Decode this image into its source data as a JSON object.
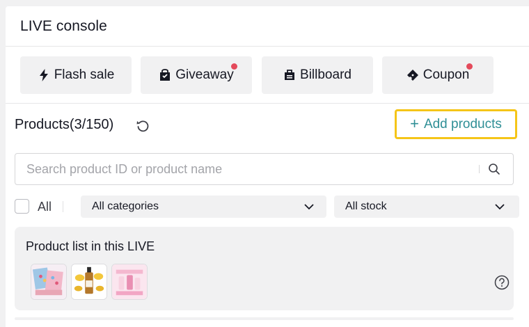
{
  "header": {
    "title": "LIVE console"
  },
  "tools": [
    {
      "label": "Flash sale",
      "icon": "lightning-icon",
      "notification": false
    },
    {
      "label": "Giveaway",
      "icon": "gift-bag-icon",
      "notification": true
    },
    {
      "label": "Billboard",
      "icon": "billboard-icon",
      "notification": false
    },
    {
      "label": "Coupon",
      "icon": "coupon-ticket-icon",
      "notification": true
    }
  ],
  "products": {
    "title": "Products(3/150)",
    "add_label": "Add products",
    "search_placeholder": "Search product ID or product name",
    "all_label": "All",
    "category_select": "All categories",
    "stock_select": "All stock",
    "list_title": "Product list in this LIVE",
    "thumbnails": [
      "product-thumbnail-1",
      "product-thumbnail-2",
      "product-thumbnail-3"
    ]
  },
  "colors": {
    "accent": "#2f8f96",
    "highlight_border": "#f5c518",
    "notification_dot": "#e44a5b",
    "button_bg": "#f1f1f2"
  }
}
